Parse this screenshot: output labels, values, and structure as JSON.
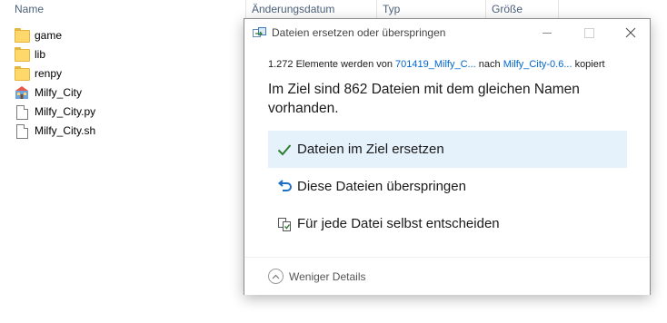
{
  "explorer": {
    "columns": [
      "Name",
      "Änderungsdatum",
      "Typ",
      "Größe"
    ],
    "files": [
      {
        "name": "game",
        "kind": "folder",
        "icon": "folder-icon"
      },
      {
        "name": "lib",
        "kind": "folder",
        "icon": "folder-icon"
      },
      {
        "name": "renpy",
        "kind": "folder",
        "icon": "folder-icon"
      },
      {
        "name": "Milfy_City",
        "kind": "application",
        "icon": "renpy-app-icon"
      },
      {
        "name": "Milfy_City.py",
        "kind": "file",
        "icon": "document-icon"
      },
      {
        "name": "Milfy_City.sh",
        "kind": "file",
        "icon": "document-icon"
      }
    ]
  },
  "dialog": {
    "title": "Dateien ersetzen oder überspringen",
    "copy_count": "1.272 Elemente werden von",
    "source": "701419_Milfy_C...",
    "word_to": "nach",
    "destination": "Milfy_City-0.6...",
    "word_copied": "kopiert",
    "headline": "Im Ziel sind 862 Dateien mit dem gleichen Namen vorhanden.",
    "options": [
      {
        "label": "Dateien im Ziel ersetzen",
        "icon": "checkmark-icon",
        "selected": true
      },
      {
        "label": "Diese Dateien überspringen",
        "icon": "skip-arrow-icon",
        "selected": false
      },
      {
        "label": "Für jede Datei selbst entscheiden",
        "icon": "compare-files-icon",
        "selected": false
      }
    ],
    "details_label": "Weniger Details",
    "colors": {
      "accent": "#0066cc",
      "selected_bg": "#e5f1fb",
      "check": "#2e7d32"
    }
  }
}
